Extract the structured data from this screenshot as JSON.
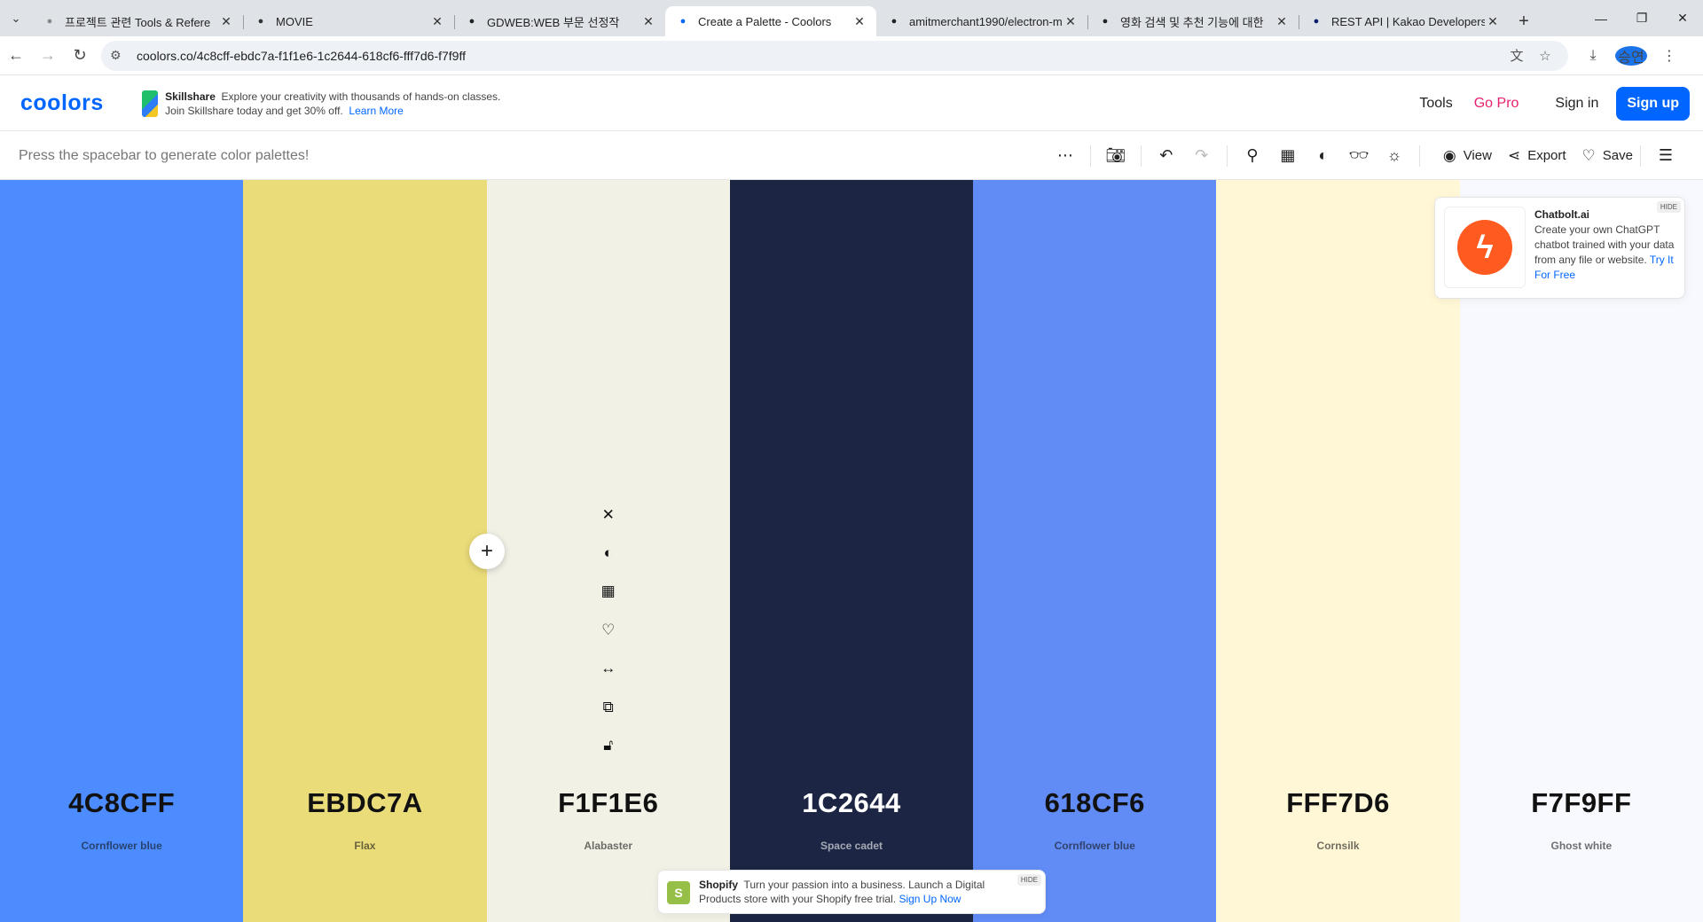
{
  "browser": {
    "tabs": [
      {
        "title": "프로젝트 관련 Tools & Refere",
        "favicon": "wrench-icon",
        "fav_color": "#888888",
        "active": false
      },
      {
        "title": "MOVIE",
        "favicon": "erd-icon",
        "fav_color": "#333333",
        "active": false
      },
      {
        "title": "GDWEB:WEB 부문 선정작",
        "favicon": "gdweb-icon",
        "fav_color": "#222222",
        "active": false
      },
      {
        "title": "Create a Palette - Coolors",
        "favicon": "coolors-icon",
        "fav_color": "#0066ff",
        "active": true
      },
      {
        "title": "amitmerchant1990/electron-m",
        "favicon": "github-icon",
        "fav_color": "#222222",
        "active": false
      },
      {
        "title": "영화 검색 및 추천 기능에 대한",
        "favicon": "movie-icon",
        "fav_color": "#222222",
        "active": false
      },
      {
        "title": "REST API | Kakao Developers",
        "favicon": "kakao-icon",
        "fav_color": "#0a1f6b",
        "active": false
      }
    ],
    "url": "coolors.co/4c8cff-ebdc7a-f1f1e6-1c2644-618cf6-fff7d6-f7f9ff",
    "profile_initials": "승연"
  },
  "header": {
    "logo": "coolors",
    "ad": {
      "brand": "Skillshare",
      "text": "Explore your creativity with thousands of hands-on classes. Join Skillshare today and get 30% off.",
      "link": "Learn More"
    },
    "nav": {
      "tools": "Tools",
      "go_pro": "Go Pro",
      "sign_in": "Sign in",
      "sign_up": "Sign up"
    }
  },
  "toolbar": {
    "hint": "Press the spacebar to generate color palettes!",
    "view": "View",
    "export": "Export",
    "save": "Save"
  },
  "palette": [
    {
      "hex": "4C8CFF",
      "name": "Cornflower blue",
      "color": "#4C8CFF",
      "text_color": "#111111"
    },
    {
      "hex": "EBDC7A",
      "name": "Flax",
      "color": "#EBDC7A",
      "text_color": "#111111"
    },
    {
      "hex": "F1F1E6",
      "name": "Alabaster",
      "color": "#F1F1E6",
      "text_color": "#111111"
    },
    {
      "hex": "1C2644",
      "name": "Space cadet",
      "color": "#1C2644",
      "text_color": "#ffffff"
    },
    {
      "hex": "618CF6",
      "name": "Cornflower blue",
      "color": "#618CF6",
      "text_color": "#111111"
    },
    {
      "hex": "FFF7D6",
      "name": "Cornsilk",
      "color": "#FFF7D6",
      "text_color": "#111111"
    },
    {
      "hex": "F7F9FF",
      "name": "Ghost white",
      "color": "#F7F9FF",
      "text_color": "#111111"
    }
  ],
  "side_ad": {
    "brand": "Chatbolt.ai",
    "text": "Create your own ChatGPT chatbot trained with your data from any file or website.",
    "link": "Try It For Free",
    "hide": "HIDE"
  },
  "bottom_ad": {
    "brand": "Shopify",
    "text": "Turn your passion into a business. Launch a Digital Products store with your Shopify free trial.",
    "link": "Sign Up Now",
    "hide": "HIDE"
  }
}
